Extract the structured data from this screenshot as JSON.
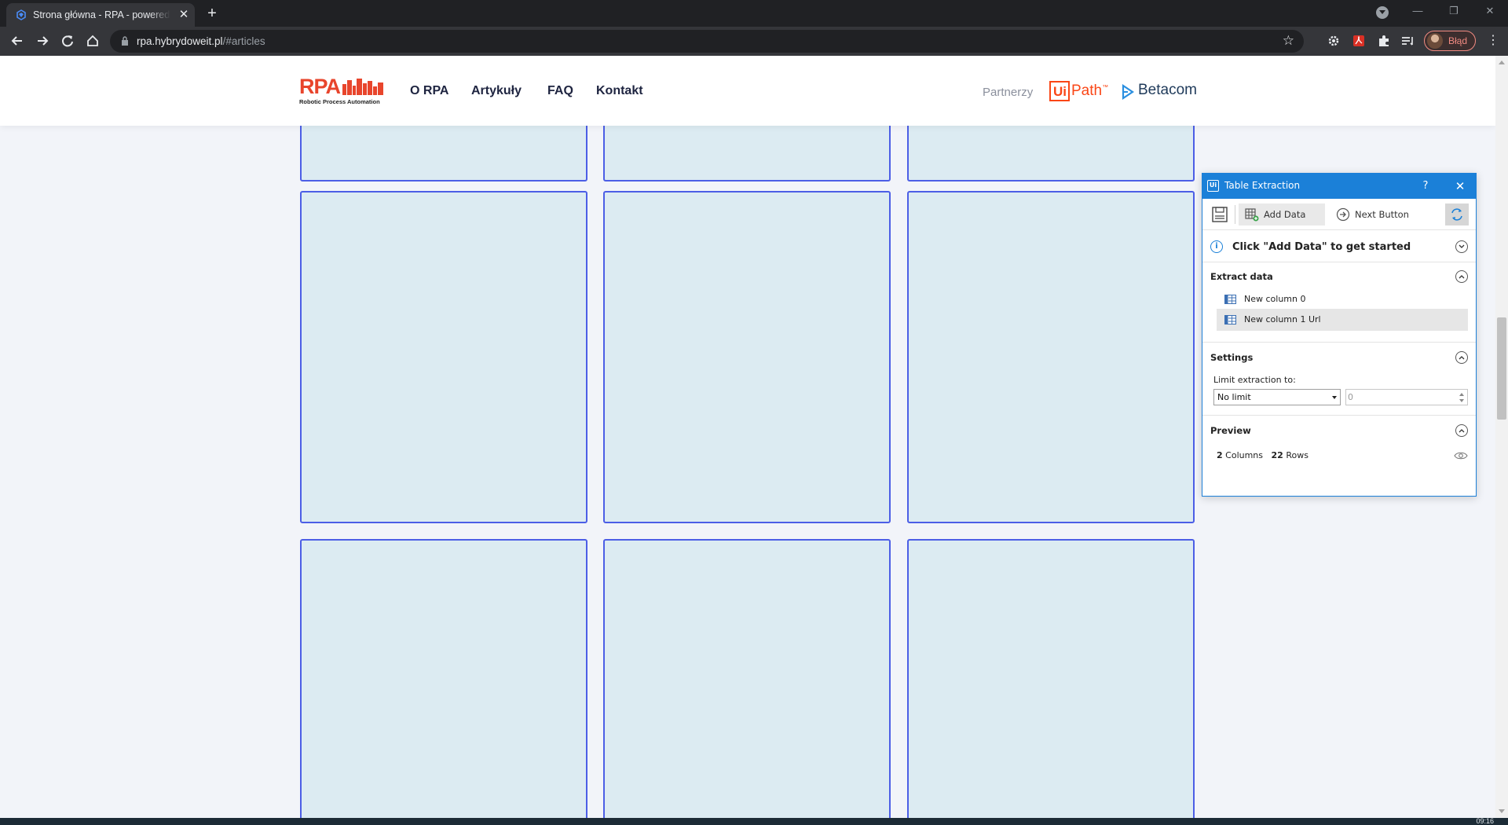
{
  "browser": {
    "tab": {
      "title": "Strona główna - RPA - powered by",
      "close": "✕"
    },
    "new_tab": "+",
    "window_controls": {
      "minimize": "—",
      "restore": "❐",
      "close": "✕"
    },
    "url": {
      "host": "rpa.hybrydoweit.pl",
      "path": "/#articles"
    },
    "bookmark": "☆",
    "profile_label": "Błąd",
    "menu": "⋮"
  },
  "site": {
    "logo": {
      "word": "RPA",
      "subtitle": "Robotic Process Automation"
    },
    "nav": [
      "O RPA",
      "Artykuły",
      "FAQ",
      "Kontakt"
    ],
    "partners_label": "Partnerzy",
    "partner_uipath": {
      "ui": "Ui",
      "path": "Path",
      "tm": "™"
    },
    "partner_betacom": "Betacom",
    "card_fill": "#dcebf2",
    "card_border": "#4c5ee6"
  },
  "panel": {
    "title": "Table Extraction",
    "help": "?",
    "close": "✕",
    "toolbar": {
      "add_data": "Add Data",
      "next_button": "Next Button"
    },
    "info": "Click \"Add Data\" to get started",
    "extract": {
      "title": "Extract data",
      "columns": [
        "New column 0",
        "New column 1 Url"
      ]
    },
    "settings": {
      "title": "Settings",
      "limit_label": "Limit extraction to:",
      "limit_value": "No limit",
      "count_value": "0"
    },
    "preview": {
      "title": "Preview",
      "columns_count": "2",
      "columns_label": "Columns",
      "rows_count": "22",
      "rows_label": "Rows"
    },
    "accent": "#1b80d8"
  },
  "taskbar": {
    "clock": "09:16"
  }
}
